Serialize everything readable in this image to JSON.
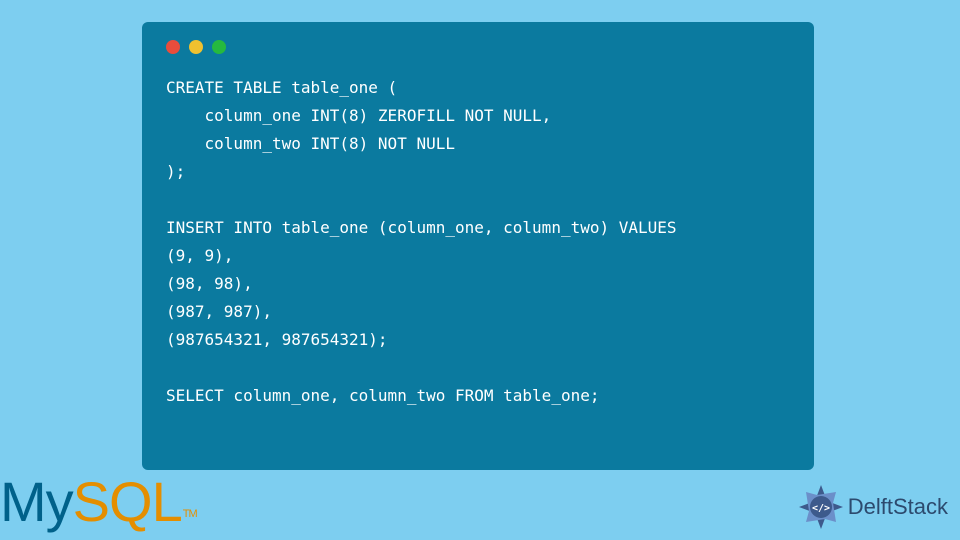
{
  "code": {
    "lines": [
      "CREATE TABLE table_one (",
      "    column_one INT(8) ZEROFILL NOT NULL,",
      "    column_two INT(8) NOT NULL",
      ");",
      "",
      "INSERT INTO table_one (column_one, column_two) VALUES",
      "(9, 9),",
      "(98, 98),",
      "(987, 987),",
      "(987654321, 987654321);",
      "",
      "SELECT column_one, column_two FROM table_one;"
    ]
  },
  "logos": {
    "mysql_my": "My",
    "mysql_sql": "SQL",
    "mysql_tm": "TM",
    "delftstack": "DelftStack"
  }
}
